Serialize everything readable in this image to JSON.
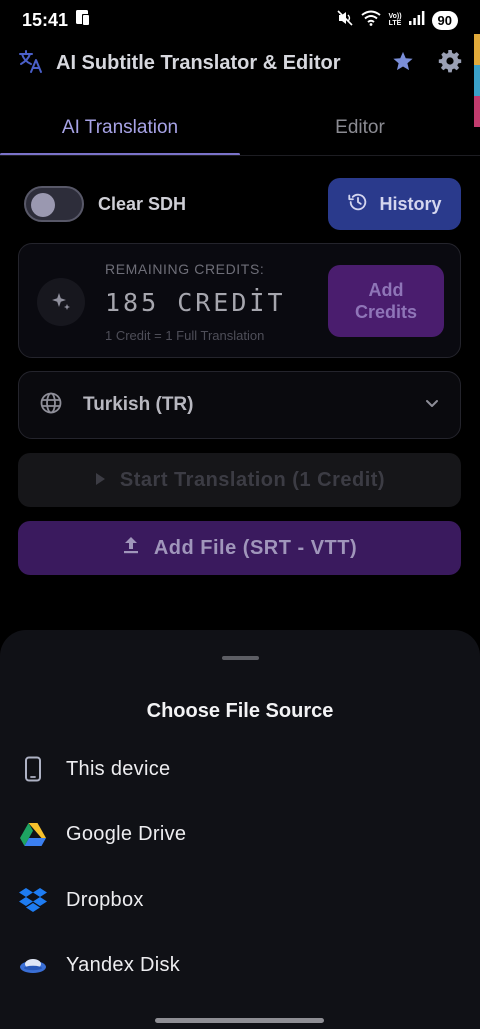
{
  "status_bar": {
    "time": "15:41",
    "battery": "90",
    "network_top": "Vo))",
    "network_bottom": "LTE"
  },
  "app_bar": {
    "title": "AI Subtitle Translator & Editor",
    "icons": [
      "translate-icon",
      "star-icon",
      "gear-icon"
    ]
  },
  "tabs": [
    {
      "label": "AI Translation",
      "active": true
    },
    {
      "label": "Editor",
      "active": false
    }
  ],
  "controls": {
    "clear_sdh_label": "Clear SDH",
    "clear_sdh_on": false,
    "history_label": "History"
  },
  "credits": {
    "heading": "REMAINING CREDITS:",
    "value": "185 CREDİT",
    "note": "1 Credit = 1 Full Translation",
    "add_button": "Add Credits"
  },
  "language": {
    "selected": "Turkish (TR)"
  },
  "actions": {
    "start_translation": "Start Translation (1 Credit)",
    "add_file": "Add File (SRT - VTT)"
  },
  "sheet": {
    "title": "Choose File Source",
    "items": [
      {
        "label": "This device",
        "icon": "phone-icon"
      },
      {
        "label": "Google Drive",
        "icon": "google-drive-icon"
      },
      {
        "label": "Dropbox",
        "icon": "dropbox-icon"
      },
      {
        "label": "Yandex Disk",
        "icon": "yandex-disk-icon"
      }
    ]
  },
  "colors": {
    "background": "#000000",
    "tab_active": "#a7a3e6",
    "history_button": "#2a3a8c",
    "add_credits_button": "#4a1d6e",
    "add_file_button": "#3a1a5e",
    "sheet_background": "#101116"
  }
}
